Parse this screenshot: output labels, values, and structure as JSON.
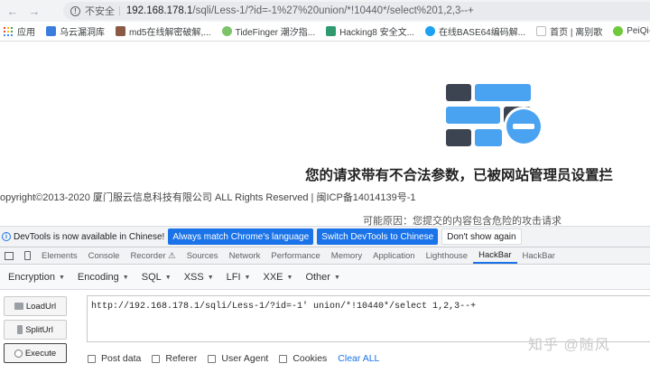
{
  "browser": {
    "nav": {
      "back_icon": "←",
      "forward_icon": "→"
    },
    "address": {
      "security_label": "不安全",
      "separator": "|",
      "host": "192.168.178.1",
      "path": "/sqli/Less-1/?id=-1%27%20union/*!10440*/select%201,2,3--+"
    },
    "bookmarks": [
      {
        "label": "应用",
        "icon": "apps-grid-icon"
      },
      {
        "label": "乌云漏洞库",
        "icon": "wooyun-icon",
        "color": "#3b7ddd"
      },
      {
        "label": "md5在线解密破解,...",
        "icon": "md5-icon",
        "color": "#8a5a44"
      },
      {
        "label": "TideFinger 潮汐指...",
        "icon": "tide-icon",
        "color": "#7cc36a"
      },
      {
        "label": "Hacking8 安全文...",
        "icon": "hacking8-icon",
        "color": "#2e9a6e"
      },
      {
        "label": "在线BASE64编码解...",
        "icon": "base64-icon",
        "color": "#1da1f2"
      },
      {
        "label": "首页 | 离别歌",
        "icon": "leavesongs-icon",
        "color": "#bbbbbb"
      },
      {
        "label": "PeiQi-POC-Wi",
        "icon": "peiqi-icon",
        "color": "#6fc93a"
      }
    ]
  },
  "page": {
    "block_message": "您的请求带有不合法参数，已被网站管理员设置拦",
    "copyright": "opyright©2013-2020 厦门服云信息科技有限公司 ALL Rights Reserved | 闽ICP备14014139号-1",
    "reason": "可能原因：您提交的内容包含危险的攻击请求"
  },
  "devtools": {
    "notice": {
      "text": "DevTools is now available in Chinese!",
      "match_label": "Always match Chrome's language",
      "switch_label": "Switch DevTools to Chinese",
      "dismiss_label": "Don't show again"
    },
    "tabs": [
      "Elements",
      "Console",
      "Recorder ⚠",
      "Sources",
      "Network",
      "Performance",
      "Memory",
      "Application",
      "Lighthouse",
      "HackBar",
      "HackBar"
    ],
    "active_tab_index": 9
  },
  "hackbar": {
    "menus": [
      "Encryption",
      "Encoding",
      "SQL",
      "XSS",
      "LFI",
      "XXE",
      "Other"
    ],
    "load_url": "LoadUrl",
    "split_url": "SplitUrl",
    "execute": "Execute",
    "url_value": "http://192.168.178.1/sqli/Less-1/?id=-1' union/*!10440*/select 1,2,3--+",
    "options": [
      "Post data",
      "Referer",
      "User Agent",
      "Cookies"
    ],
    "clear_all": "Clear ALL"
  },
  "watermark": "知乎 @随风",
  "colors": {
    "accent": "#1a73e8",
    "logo_blue": "#4aa3f0",
    "logo_dark": "#3d4451"
  }
}
